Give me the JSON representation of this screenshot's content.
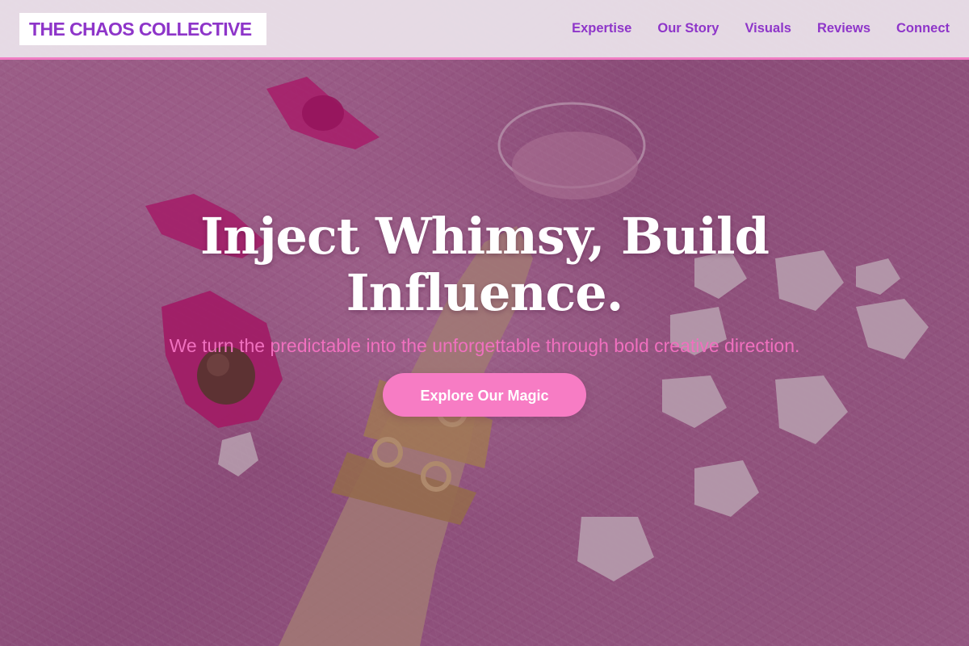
{
  "header": {
    "logo_text": "THE CHAOS COLLECTIVE",
    "nav": [
      {
        "label": "Expertise"
      },
      {
        "label": "Our Story"
      },
      {
        "label": "Visuals"
      },
      {
        "label": "Reviews"
      },
      {
        "label": "Connect"
      }
    ]
  },
  "hero": {
    "title": "Inject Whimsy, Build Influence.",
    "subtitle": "We turn the predictable into the unforgettable through bold creative direction.",
    "cta_label": "Explore Our Magic",
    "background_image": "pink-fur-hand-bracelets-cocktail-candies-petals"
  },
  "colors": {
    "brand_purple": "#8e35c9",
    "accent_pink": "#f77cc4",
    "header_border": "#f07cc3",
    "subtitle_pink": "#f070bf"
  }
}
